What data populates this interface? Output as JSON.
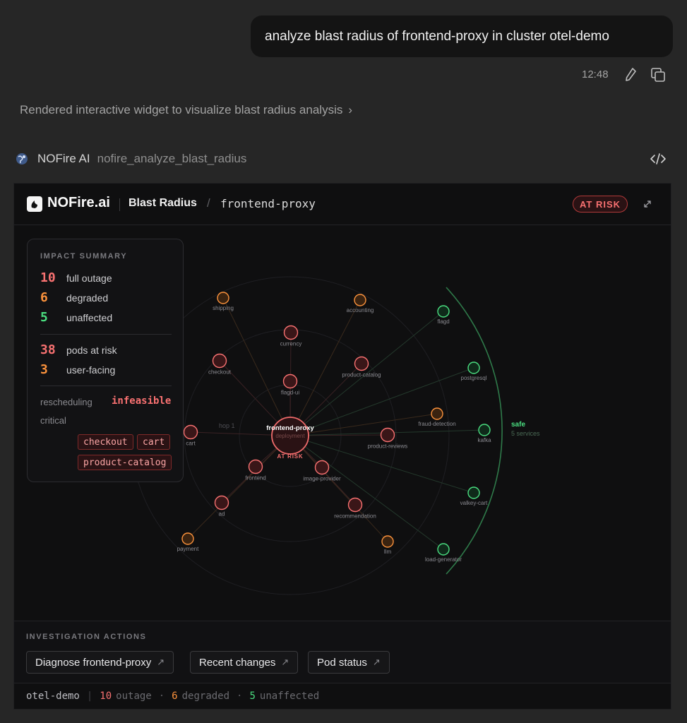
{
  "chat": {
    "user_message": "analyze blast radius of frontend-proxy in cluster otel-demo",
    "time": "12:48",
    "render_note": "Rendered interactive widget to visualize blast radius analysis",
    "render_note_chevron": "›",
    "tool_agent": "NOFire AI",
    "tool_function": "nofire_analyze_blast_radius"
  },
  "widget": {
    "brand": "NOFire.ai",
    "title": "Blast Radius",
    "slash": "/",
    "target": "frontend-proxy",
    "status_badge": "AT RISK",
    "summary": {
      "heading": "IMPACT SUMMARY",
      "full_outage_count": "10",
      "full_outage_label": "full outage",
      "degraded_count": "6",
      "degraded_label": "degraded",
      "unaffected_count": "5",
      "unaffected_label": "unaffected",
      "pods_count": "38",
      "pods_label": "pods at risk",
      "user_facing_count": "3",
      "user_facing_label": "user-facing",
      "rescheduling_label": "rescheduling",
      "rescheduling_value": "infeasible",
      "critical_label": "critical",
      "critical_services": [
        "checkout",
        "cart",
        "product-catalog"
      ]
    },
    "graph": {
      "center_name": "frontend-proxy",
      "center_kind": "deployment",
      "center_status": "AT RISK",
      "hop_label": "hop 1",
      "safe_label": "safe",
      "safe_sub": "5 services",
      "colors": {
        "outage": "#f87171",
        "degraded": "#fb923c",
        "safe": "#4ade80"
      },
      "nodes": [
        {
          "name": "shipping",
          "status": "degraded"
        },
        {
          "name": "accounting",
          "status": "degraded"
        },
        {
          "name": "flagd",
          "status": "safe"
        },
        {
          "name": "currency",
          "status": "outage"
        },
        {
          "name": "checkout",
          "status": "outage"
        },
        {
          "name": "product-catalog",
          "status": "outage"
        },
        {
          "name": "postgresql",
          "status": "safe"
        },
        {
          "name": "flagd-ui",
          "status": "outage"
        },
        {
          "name": "fraud-detection",
          "status": "degraded"
        },
        {
          "name": "cart",
          "status": "outage"
        },
        {
          "name": "product-reviews",
          "status": "outage"
        },
        {
          "name": "kafka",
          "status": "safe"
        },
        {
          "name": "frontend",
          "status": "outage"
        },
        {
          "name": "image-provider",
          "status": "outage"
        },
        {
          "name": "valkey-cart",
          "status": "safe"
        },
        {
          "name": "ad",
          "status": "outage"
        },
        {
          "name": "recommendation",
          "status": "outage"
        },
        {
          "name": "payment",
          "status": "degraded"
        },
        {
          "name": "llm",
          "status": "degraded"
        },
        {
          "name": "load-generator",
          "status": "safe"
        }
      ]
    },
    "actions": {
      "heading": "INVESTIGATION ACTIONS",
      "buttons": [
        "Diagnose frontend-proxy",
        "Recent changes",
        "Pod status"
      ],
      "arrow": "↗"
    },
    "footer": {
      "cluster": "otel-demo",
      "outage_count": "10",
      "outage_label": "outage",
      "degraded_count": "6",
      "degraded_label": "degraded",
      "unaffected_count": "5",
      "unaffected_label": "unaffected"
    }
  }
}
